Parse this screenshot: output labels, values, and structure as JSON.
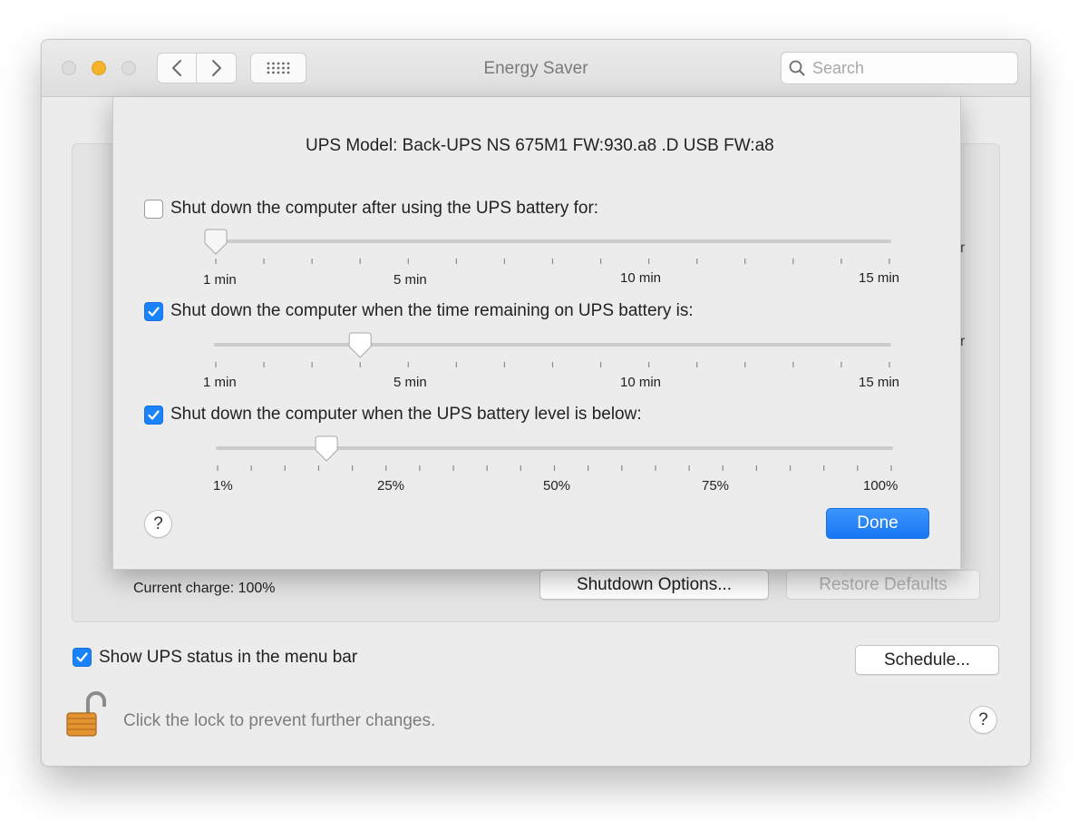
{
  "window": {
    "title": "Energy Saver"
  },
  "toolbar": {
    "search_placeholder": "Search"
  },
  "background": {
    "current_charge": "Current charge: 100%",
    "shutdown_options_label": "Shutdown Options...",
    "restore_defaults_label": "Restore Defaults",
    "show_ups_status_label": "Show UPS status in the menu bar",
    "show_ups_status_checked": true,
    "schedule_label": "Schedule...",
    "lock_text": "Click the lock to prevent further changes.",
    "help_label": "?",
    "partial_glyph": "r"
  },
  "sheet": {
    "ups_model": "UPS Model:  Back-UPS NS 675M1 FW:930.a8 .D USB FW:a8",
    "options": [
      {
        "label": "Shut down the computer after using the UPS battery for:",
        "checked": false,
        "enabled": false,
        "tick_labels": [
          "1 min",
          "5 min",
          "10 min",
          "15 min"
        ],
        "min": 1,
        "max": 15,
        "value": 1,
        "unit": "min"
      },
      {
        "label": "Shut down the computer when the time remaining on UPS battery is:",
        "checked": true,
        "enabled": true,
        "tick_labels": [
          "1 min",
          "5 min",
          "10 min",
          "15 min"
        ],
        "min": 1,
        "max": 15,
        "value": 4,
        "unit": "min"
      },
      {
        "label": "Shut down the computer when the UPS battery level is below:",
        "checked": true,
        "enabled": true,
        "tick_labels": [
          "1%",
          "25%",
          "50%",
          "75%",
          "100%"
        ],
        "min": 1,
        "max": 100,
        "value": 17,
        "unit": "%"
      }
    ],
    "help_label": "?",
    "done_label": "Done"
  },
  "colors": {
    "accent": "#1a82fb",
    "window_bg": "#ececec",
    "lock_body": "#e39330"
  },
  "icons": [
    "back-icon",
    "forward-icon",
    "grid-icon",
    "search-icon",
    "checkmark-icon",
    "lock-open-icon"
  ]
}
